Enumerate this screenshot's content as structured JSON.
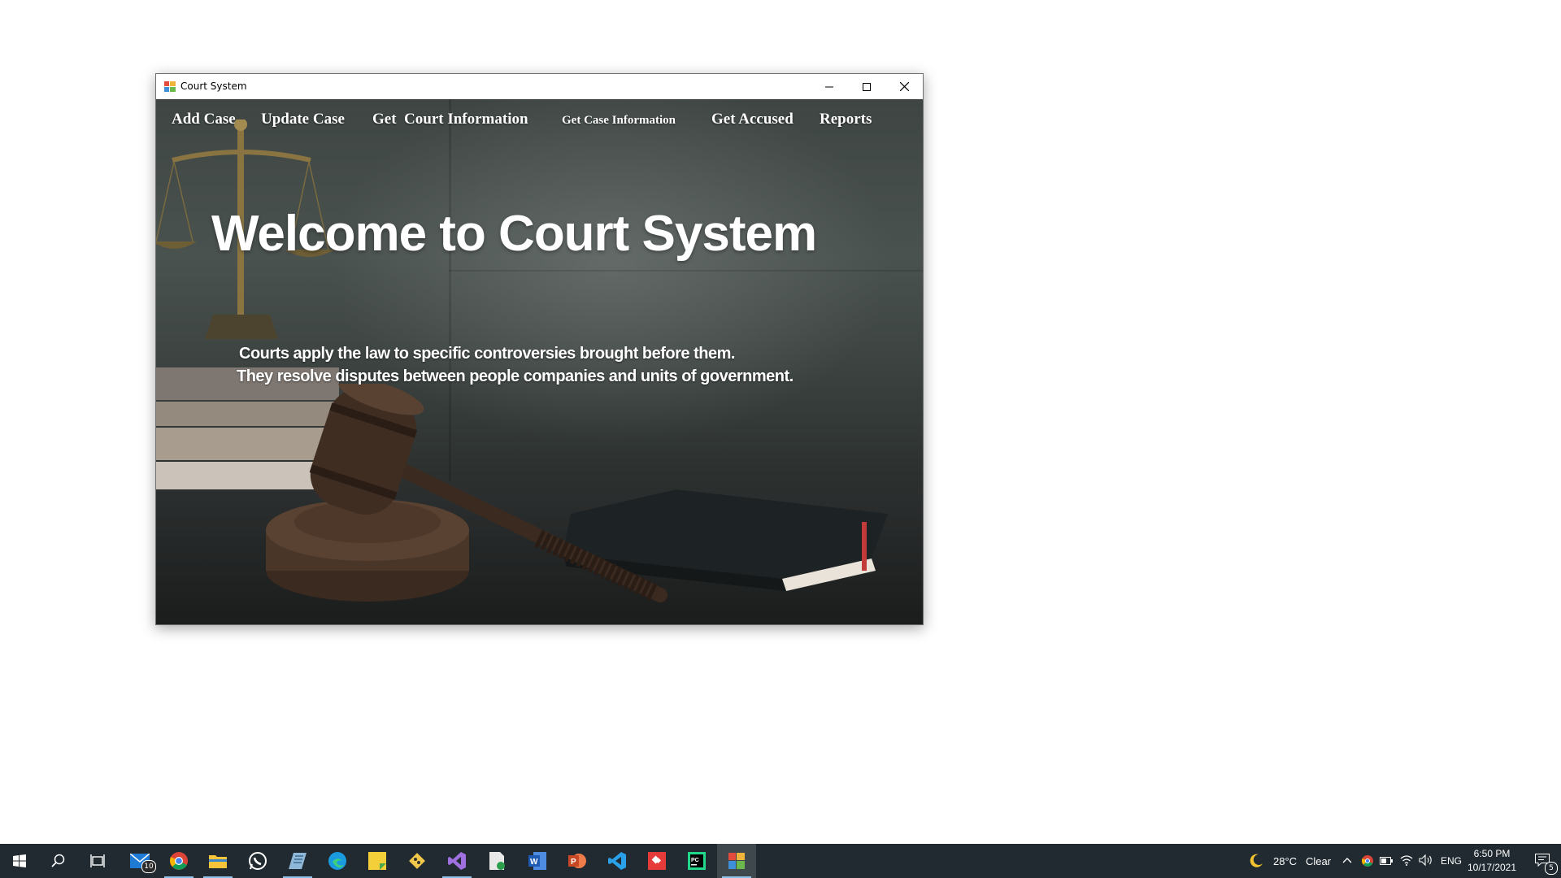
{
  "window": {
    "title": "Court System",
    "controls": {
      "minimize": "minimize-icon",
      "maximize": "maximize-icon",
      "close": "close-icon"
    }
  },
  "menu": {
    "items": [
      "Add Case",
      "Update Case",
      "Get  Court Information",
      "Get Case Information",
      "Get Accused",
      "Reports"
    ]
  },
  "main": {
    "headline": "Welcome to Court System",
    "lines": [
      "Courts apply the law to specific controversies brought before them.",
      "They resolve disputes between people companies and units of government."
    ]
  },
  "taskbar": {
    "apps": [
      {
        "name": "start-icon"
      },
      {
        "name": "search-icon"
      },
      {
        "name": "task-view-icon"
      },
      {
        "name": "mail-icon",
        "badge": "10"
      },
      {
        "name": "chrome-icon",
        "running": true
      },
      {
        "name": "file-explorer-icon",
        "running": true
      },
      {
        "name": "whatsapp-icon"
      },
      {
        "name": "notepad-icon",
        "running": true
      },
      {
        "name": "edge-icon"
      },
      {
        "name": "sticky-notes-icon"
      },
      {
        "name": "git-icon"
      },
      {
        "name": "visual-studio-icon",
        "running": true
      },
      {
        "name": "document-app-icon"
      },
      {
        "name": "word-icon"
      },
      {
        "name": "powerpoint-icon"
      },
      {
        "name": "vscode-icon"
      },
      {
        "name": "anydesk-icon"
      },
      {
        "name": "pycharm-icon"
      },
      {
        "name": "court-system-app-icon",
        "active": true
      }
    ],
    "weather": {
      "icon": "moon-icon",
      "temp": "28°C",
      "condition": "Clear"
    },
    "tray": {
      "language": "ENG",
      "time": "6:50 PM",
      "date": "10/17/2021",
      "notifications": "5"
    }
  },
  "colors": {
    "taskbar_bg": "#202a30",
    "running_indicator": "#8fc0e8",
    "menu_text": "#ffffff"
  }
}
